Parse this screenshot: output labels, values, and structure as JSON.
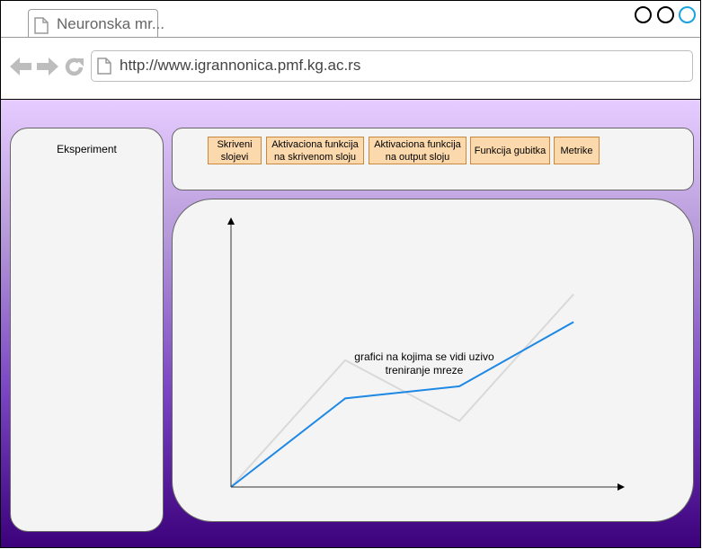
{
  "browser": {
    "tab_title": "Neuronska mr...",
    "url": "http://www.igrannonica.pmf.kg.ac.rs",
    "window_buttons": [
      "minimize-button",
      "maximize-button",
      "close-button"
    ],
    "accent_color": "#1ba1e2"
  },
  "sidebar": {
    "title": "Eksperiment"
  },
  "toolbar": {
    "items": [
      {
        "label": "Skriveni\nslojevi"
      },
      {
        "label": "Aktivaciona funkcija\nna skrivenom sloju"
      },
      {
        "label": "Aktivaciona funkcija\nna output sloju"
      },
      {
        "label": "Funkcija gubitka"
      },
      {
        "label": "Metrike"
      }
    ],
    "button_color": "#fcd9ad"
  },
  "chart": {
    "note": "grafici na kojima se vidi uzivo\ntreniranje mreze"
  },
  "chart_data": {
    "type": "line",
    "title": "",
    "xlabel": "",
    "ylabel": "",
    "x": [
      0,
      1,
      2,
      3
    ],
    "series": [
      {
        "color": "#1e88e5",
        "values": [
          0,
          0.51,
          0.58,
          0.95
        ]
      },
      {
        "color": "#d9d9d9",
        "values": [
          0,
          0.73,
          0.38,
          1.11
        ]
      }
    ],
    "xlim": [
      0,
      3.4
    ],
    "ylim": [
      0,
      1.5
    ],
    "grid": false
  }
}
